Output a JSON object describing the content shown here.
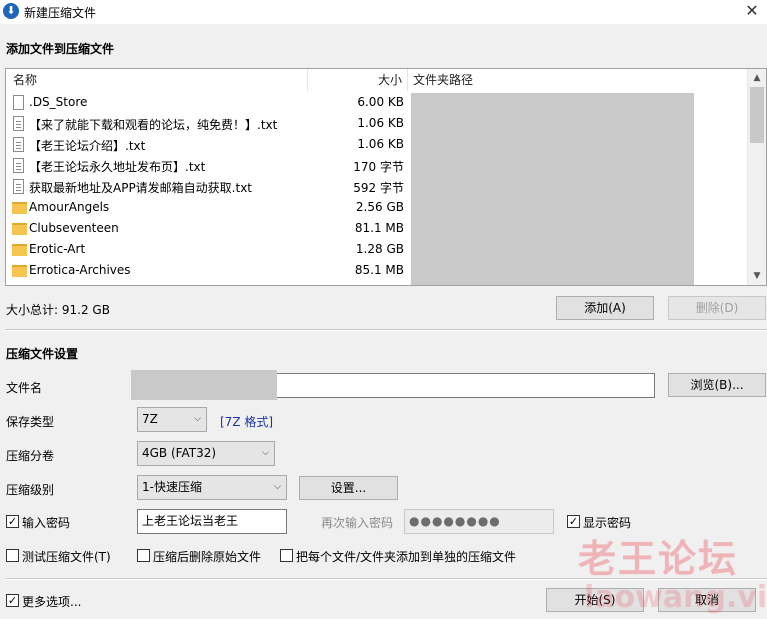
{
  "window": {
    "title": "新建压缩文件",
    "close_glyph": "✕",
    "app_icon": "download-arrow-icon"
  },
  "add_section": {
    "title": "添加文件到压缩文件"
  },
  "filelist": {
    "headers": {
      "name": "名称",
      "size": "大小",
      "path": "文件夹路径"
    },
    "rows": [
      {
        "name": ".DS_Store",
        "size": "6.00 KB",
        "icon": "file"
      },
      {
        "name": "【来了就能下载和观看的论坛，纯免费！】.txt",
        "size": "1.06 KB",
        "icon": "txt"
      },
      {
        "name": "【老王论坛介绍】.txt",
        "size": "1.06 KB",
        "icon": "txt"
      },
      {
        "name": "【老王论坛永久地址发布页】.txt",
        "size": "170 字节",
        "icon": "txt"
      },
      {
        "name": "获取最新地址及APP请发邮箱自动获取.txt",
        "size": "592 字节",
        "icon": "txt"
      },
      {
        "name": "AmourAngels",
        "size": "2.56 GB",
        "icon": "folder"
      },
      {
        "name": "Clubseventeen",
        "size": "81.1 MB",
        "icon": "folder"
      },
      {
        "name": "Erotic-Art",
        "size": "1.28 GB",
        "icon": "folder"
      },
      {
        "name": "Errotica-Archives",
        "size": "85.1 MB",
        "icon": "folder"
      }
    ]
  },
  "summary": {
    "total": "大小总计: 91.2 GB"
  },
  "buttons": {
    "add": "添加(A)",
    "delete": "删除(D)",
    "browse": "浏览(B)...",
    "settings": "设置...",
    "start": "开始(S)",
    "cancel": "取消"
  },
  "settings_section": {
    "title": "压缩文件设置",
    "filename_label": "文件名",
    "save_type_label": "保存类型",
    "save_type_value": "7Z",
    "format_link": "[7Z 格式]",
    "split_label": "压缩分卷",
    "split_value": "4GB (FAT32)",
    "level_label": "压缩级别",
    "level_value": "1-快速压缩",
    "password_label": "输入密码",
    "password_checked": true,
    "password_value": "上老王论坛当老王",
    "reenter_label": "再次输入密码",
    "reenter_value": "●●●●●●●●",
    "show_password_label": "显示密码",
    "show_password_checked": true,
    "test_label": "测试压缩文件(T)",
    "delete_original_label": "压缩后删除原始文件",
    "each_file_label": "把每个文件/文件夹添加到单独的压缩文件",
    "more_options_label": "更多选项...",
    "more_options_checked": true
  },
  "watermark": {
    "text": "老王论坛",
    "url": "laowang.vip"
  }
}
